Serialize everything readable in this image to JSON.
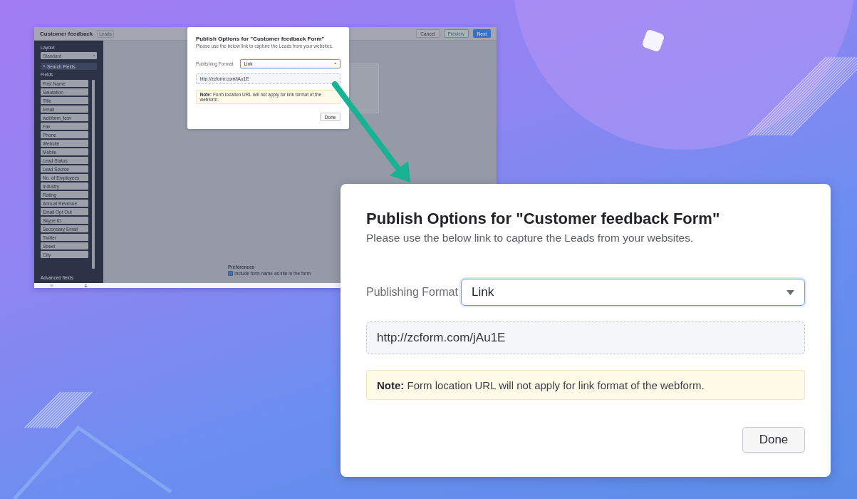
{
  "app": {
    "title": "Customer feedback",
    "module": "Leads",
    "buttons": [
      {
        "label": "Cancel",
        "kind": "secondary"
      },
      {
        "label": "Preview",
        "kind": "outline"
      },
      {
        "label": "Next",
        "kind": "primary"
      }
    ],
    "sidebar": {
      "layout_label": "Layout",
      "layout_value": "Standard",
      "search_placeholder": "Search Fields",
      "fields_heading": "Fields",
      "fields": [
        "First Name",
        "Salutation",
        "Title",
        "Email",
        "webform_test",
        "Fax",
        "Phone",
        "Website",
        "Mobile",
        "Lead Status",
        "Lead Source",
        "No. of Employees",
        "Industry",
        "Rating",
        "Annual Revenue",
        "Email Opt Out",
        "Skype ID",
        "Secondary Email",
        "Twitter",
        "Street",
        "City"
      ],
      "advanced": "Advanced fields"
    },
    "preferences": {
      "heading": "Preferences",
      "option": {
        "label": "Include form name as title in the form",
        "checked": true
      }
    },
    "dialog": {
      "title": "Publish Options for \"Customer feedback Form\"",
      "subtitle": "Please use the below link to capture the Leads from your websites.",
      "format_label": "Publishing Format",
      "format_value": "Link",
      "url": "http://zcform.com/jAu1E",
      "note": "**Note:** Form location URL will not apply for link format of the webform.",
      "done": "Done"
    }
  },
  "zoomed_dialog": {
    "title": "Publish Options for \"Customer feedback Form\"",
    "subtitle": "Please use the below link to capture the Leads from your websites.",
    "format_label": "Publishing Format",
    "format_value": "Link",
    "url": "http://zcform.com/jAu1E",
    "note": "**Note:** Form location URL will not apply for link format of the webform.",
    "done": "Done"
  }
}
